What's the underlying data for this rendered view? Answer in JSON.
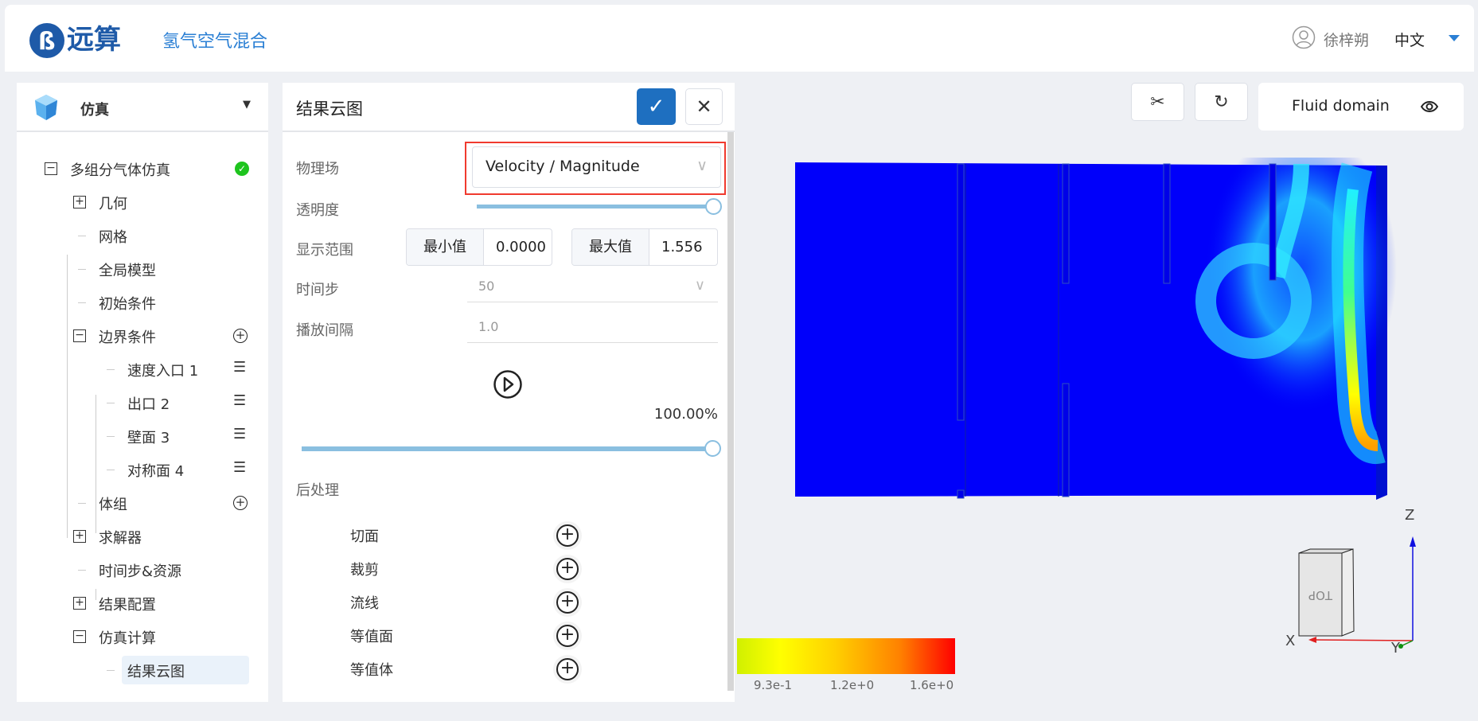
{
  "header": {
    "logo": "远算",
    "app_title": "氢气空气混合",
    "user": "徐梓朔",
    "language": "中文"
  },
  "left": {
    "title": "仿真",
    "tree": [
      {
        "label": "多组分气体仿真",
        "level": 0,
        "toggle": "-",
        "status": "done"
      },
      {
        "label": "几何",
        "level": 1,
        "toggle": "+"
      },
      {
        "label": "网格",
        "level": 1
      },
      {
        "label": "全局模型",
        "level": 1
      },
      {
        "label": "初始条件",
        "level": 1
      },
      {
        "label": "边界条件",
        "level": 1,
        "toggle": "-",
        "action": "add"
      },
      {
        "label": "速度入口 1",
        "level": 2,
        "action": "list"
      },
      {
        "label": "出口 2",
        "level": 2,
        "action": "list"
      },
      {
        "label": "壁面 3",
        "level": 2,
        "action": "list"
      },
      {
        "label": "对称面 4",
        "level": 2,
        "action": "list"
      },
      {
        "label": "体组",
        "level": 1,
        "action": "add"
      },
      {
        "label": "求解器",
        "level": 1,
        "toggle": "+"
      },
      {
        "label": "时间步&资源",
        "level": 1
      },
      {
        "label": "结果配置",
        "level": 1,
        "toggle": "+"
      },
      {
        "label": "仿真计算",
        "level": 1,
        "toggle": "-"
      },
      {
        "label": "结果云图",
        "level": 2,
        "selected": true
      }
    ]
  },
  "panel": {
    "title": "结果云图",
    "field_label": "物理场",
    "field_value": "Velocity / Magnitude",
    "opacity_label": "透明度",
    "opacity": 1.0,
    "range_label": "显示范围",
    "min_label": "最小值",
    "min_value": "0.0000",
    "max_label": "最大值",
    "max_value": "1.556",
    "timestep_label": "时间步",
    "timestep_value": "50",
    "interval_label": "播放间隔",
    "interval_value": "1.0",
    "progress_text": "100.00%",
    "progress": 1.0,
    "post_label": "后处理",
    "post_items": [
      "切面",
      "裁剪",
      "流线",
      "等值面",
      "等值体"
    ]
  },
  "viewport": {
    "domain_label": "Fluid domain",
    "legend_labels": [
      "9.3e-1",
      "1.2e+0",
      "1.6e+0"
    ],
    "axes": {
      "x": "X",
      "y": "Y",
      "z": "Z"
    },
    "cube_face": "TOP"
  },
  "colors": {
    "accent": "#1e6fc0",
    "highlight": "#f03a2e",
    "field_low": "#0000ff",
    "field_high": "#ff0000"
  }
}
